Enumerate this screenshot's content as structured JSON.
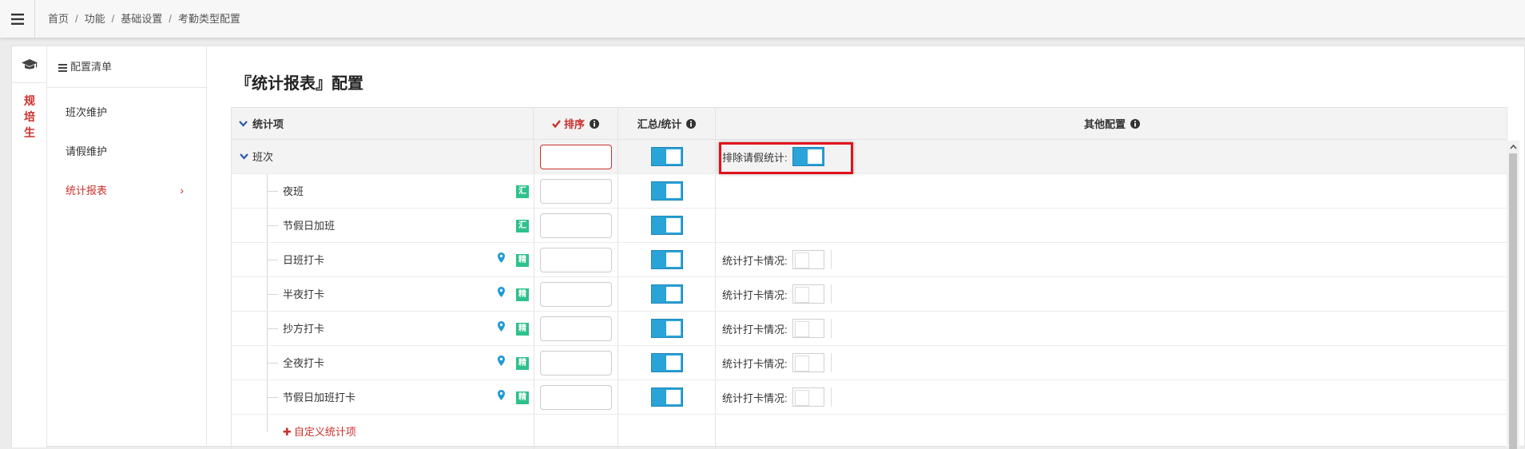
{
  "breadcrumb": [
    "首页",
    "功能",
    "基础设置",
    "考勤类型配置"
  ],
  "rail": {
    "chars": [
      "规",
      "培",
      "生"
    ]
  },
  "menu": {
    "title": "配置清单",
    "items": [
      {
        "label": "班次维护"
      },
      {
        "label": "请假维护"
      },
      {
        "label": "统计报表"
      }
    ],
    "active_chevron": "›"
  },
  "page_title": "『统计报表』配置",
  "table": {
    "headers": {
      "item": "统计项",
      "order": "排序",
      "summary": "汇总/统计",
      "other": "其他配置"
    },
    "group": {
      "name": "班次",
      "other_label": "排除请假统计:",
      "other_toggle": true,
      "summary_toggle": true
    },
    "rows": [
      {
        "name": "夜班",
        "badge": "汇",
        "pin": false,
        "summary_toggle": true,
        "other_label": "",
        "other_toggle": null
      },
      {
        "name": "节假日加班",
        "badge": "汇",
        "pin": false,
        "summary_toggle": true,
        "other_label": "",
        "other_toggle": null
      },
      {
        "name": "日班打卡",
        "badge": "精",
        "pin": true,
        "summary_toggle": true,
        "other_label": "统计打卡情况:",
        "other_toggle": false
      },
      {
        "name": "半夜打卡",
        "badge": "精",
        "pin": true,
        "summary_toggle": true,
        "other_label": "统计打卡情况:",
        "other_toggle": false
      },
      {
        "name": "抄方打卡",
        "badge": "精",
        "pin": true,
        "summary_toggle": true,
        "other_label": "统计打卡情况:",
        "other_toggle": false
      },
      {
        "name": "全夜打卡",
        "badge": "精",
        "pin": true,
        "summary_toggle": true,
        "other_label": "统计打卡情况:",
        "other_toggle": false
      },
      {
        "name": "节假日加班打卡",
        "badge": "精",
        "pin": true,
        "summary_toggle": true,
        "other_label": "统计打卡情况:",
        "other_toggle": false
      }
    ],
    "add_label": "自定义统计项"
  },
  "colors": {
    "accent_red": "#c9302c",
    "toggle_blue": "#29a3d8",
    "badge_green": "#2ec18c",
    "highlight_red": "#e3111b",
    "caret_blue": "#2a5aa8"
  }
}
